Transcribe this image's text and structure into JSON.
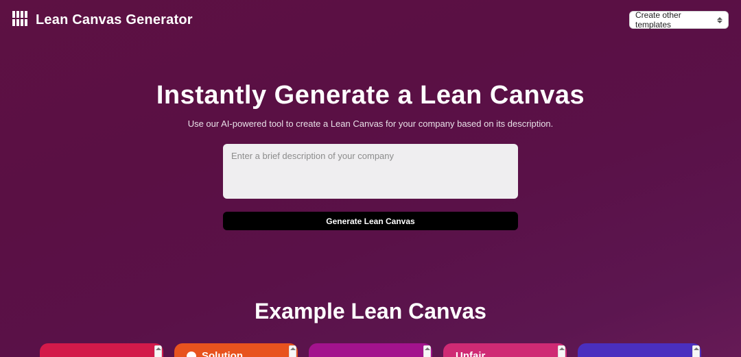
{
  "header": {
    "brand_title": "Lean Canvas Generator",
    "template_select_label": "Create other templates"
  },
  "hero": {
    "title": "Instantly Generate a Lean Canvas",
    "subtitle": "Use our AI-powered tool to create a Lean Canvas for your company based on its description.",
    "placeholder": "Enter a brief description of your company",
    "button_label": "Generate Lean Canvas"
  },
  "example": {
    "title": "Example Lean Canvas",
    "cards": [
      {
        "label": ""
      },
      {
        "label": "Solution"
      },
      {
        "label": ""
      },
      {
        "label": "Unfair"
      },
      {
        "label": ""
      }
    ]
  }
}
